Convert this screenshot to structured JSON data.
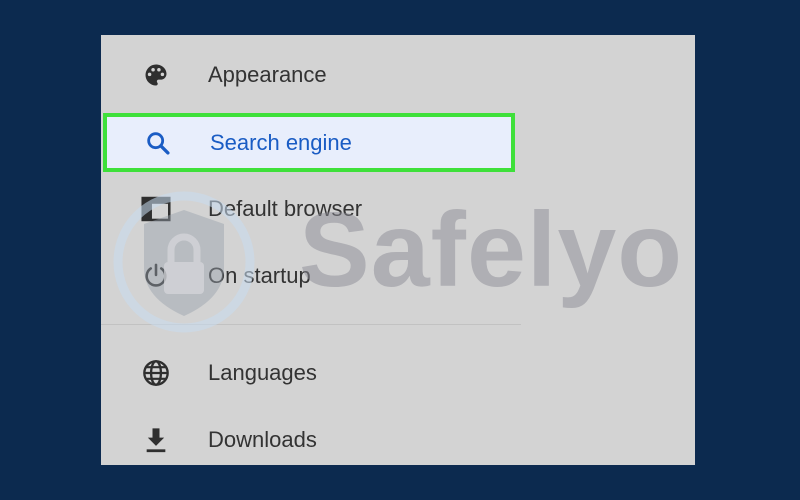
{
  "menu": {
    "items": [
      {
        "label": "Appearance",
        "icon": "palette-icon"
      },
      {
        "label": "Search engine",
        "icon": "search-icon",
        "selected": true
      },
      {
        "label": "Default browser",
        "icon": "browser-window-icon"
      },
      {
        "label": "On startup",
        "icon": "power-icon"
      },
      {
        "label": "Languages",
        "icon": "globe-icon"
      },
      {
        "label": "Downloads",
        "icon": "download-icon"
      }
    ]
  },
  "watermark": {
    "text": "Safelyo"
  },
  "colors": {
    "background": "#0c2a4f",
    "panel": "#d3d3d3",
    "selected_bg": "#e8eefc",
    "selected_text": "#1a5cc4",
    "highlight_border": "#3ee03a",
    "text": "#333333"
  }
}
